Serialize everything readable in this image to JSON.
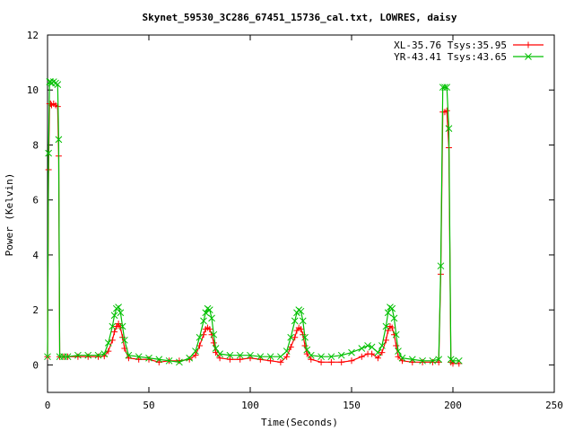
{
  "chart_data": {
    "type": "line",
    "title": "Skynet_59530_3C286_67451_15736_cal.txt, LOWRES, daisy",
    "xlabel": "Time(Seconds)",
    "ylabel": "Power (Kelvin)",
    "xlim": [
      0,
      250
    ],
    "ylim": [
      -1,
      12
    ],
    "xticks": [
      0,
      50,
      100,
      150,
      200,
      250
    ],
    "yticks": [
      0,
      2,
      4,
      6,
      8,
      10,
      12
    ],
    "grid": false,
    "legend_position": "top-right",
    "series": [
      {
        "name": "XL-35.76 Tsys:35.95",
        "color": "#ff0000",
        "marker": "plus",
        "x": [
          0,
          0.5,
          1,
          1.5,
          2,
          3,
          4,
          5,
          5.5,
          6,
          8,
          10,
          15,
          20,
          25,
          28,
          30,
          32,
          33,
          34,
          35,
          36,
          37,
          38,
          40,
          45,
          50,
          55,
          60,
          65,
          70,
          73,
          75,
          77,
          78,
          79,
          80,
          81,
          82,
          83,
          85,
          90,
          95,
          100,
          105,
          110,
          115,
          118,
          120,
          122,
          123,
          124,
          125,
          126,
          127,
          128,
          130,
          135,
          140,
          145,
          150,
          155,
          158,
          160,
          163,
          165,
          167,
          168,
          169,
          170,
          171,
          172,
          173,
          175,
          180,
          185,
          190,
          193,
          194,
          195,
          196,
          197,
          198,
          199,
          200,
          203
        ],
        "y": [
          0.3,
          7.1,
          9.5,
          9.5,
          9.45,
          9.5,
          9.45,
          9.4,
          7.6,
          0.3,
          0.3,
          0.3,
          0.3,
          0.3,
          0.3,
          0.32,
          0.5,
          0.9,
          1.2,
          1.4,
          1.5,
          1.35,
          1.0,
          0.6,
          0.25,
          0.2,
          0.2,
          0.1,
          0.15,
          0.15,
          0.2,
          0.35,
          0.7,
          1.1,
          1.3,
          1.35,
          1.3,
          1.1,
          0.8,
          0.45,
          0.25,
          0.2,
          0.2,
          0.25,
          0.2,
          0.15,
          0.1,
          0.3,
          0.65,
          1.0,
          1.25,
          1.35,
          1.3,
          1.1,
          0.7,
          0.4,
          0.2,
          0.1,
          0.1,
          0.1,
          0.15,
          0.3,
          0.4,
          0.4,
          0.25,
          0.45,
          0.9,
          1.25,
          1.4,
          1.35,
          1.1,
          0.7,
          0.3,
          0.15,
          0.1,
          0.1,
          0.1,
          0.1,
          3.3,
          9.2,
          9.2,
          9.25,
          7.9,
          0.1,
          0.05,
          0.05
        ]
      },
      {
        "name": "YR-43.41 Tsys:43.65",
        "color": "#00c000",
        "marker": "cross",
        "x": [
          0,
          0.5,
          1,
          1.5,
          2,
          3,
          4,
          5,
          5.5,
          6,
          8,
          10,
          15,
          20,
          25,
          28,
          30,
          32,
          33,
          34,
          35,
          36,
          37,
          38,
          40,
          45,
          50,
          55,
          60,
          65,
          70,
          73,
          75,
          77,
          78,
          79,
          80,
          81,
          82,
          83,
          85,
          90,
          95,
          100,
          105,
          110,
          115,
          118,
          120,
          122,
          123,
          124,
          125,
          126,
          127,
          128,
          130,
          135,
          140,
          145,
          150,
          155,
          158,
          160,
          163,
          165,
          167,
          168,
          169,
          170,
          171,
          172,
          173,
          175,
          180,
          185,
          190,
          193,
          194,
          195,
          196,
          197,
          198,
          199,
          200,
          203
        ],
        "y": [
          0.3,
          7.7,
          10.3,
          10.3,
          10.25,
          10.3,
          10.25,
          10.2,
          8.2,
          0.3,
          0.3,
          0.3,
          0.35,
          0.35,
          0.35,
          0.4,
          0.8,
          1.4,
          1.8,
          2.05,
          2.1,
          1.9,
          1.4,
          0.9,
          0.35,
          0.3,
          0.25,
          0.2,
          0.15,
          0.1,
          0.25,
          0.5,
          1.0,
          1.6,
          1.9,
          2.05,
          2.0,
          1.7,
          1.1,
          0.6,
          0.4,
          0.35,
          0.35,
          0.35,
          0.3,
          0.3,
          0.3,
          0.5,
          1.0,
          1.6,
          1.9,
          2.0,
          1.95,
          1.6,
          1.0,
          0.55,
          0.35,
          0.3,
          0.3,
          0.35,
          0.45,
          0.6,
          0.7,
          0.65,
          0.45,
          0.7,
          1.4,
          1.9,
          2.1,
          2.05,
          1.7,
          1.1,
          0.5,
          0.25,
          0.2,
          0.15,
          0.15,
          0.2,
          3.6,
          10.1,
          10.1,
          10.1,
          8.6,
          0.2,
          0.15,
          0.15
        ]
      }
    ]
  }
}
